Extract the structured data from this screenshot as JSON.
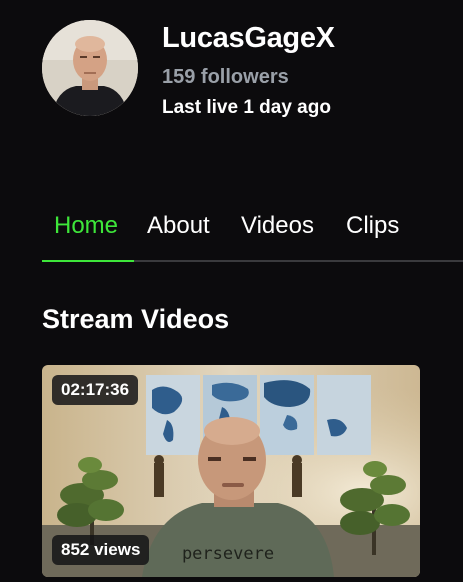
{
  "channel": {
    "name": "LucasGageX",
    "followers": "159 followers",
    "last_live": "Last live 1 day ago"
  },
  "tabs": [
    {
      "label": "Home",
      "active": true
    },
    {
      "label": "About",
      "active": false
    },
    {
      "label": "Videos",
      "active": false
    },
    {
      "label": "Clips",
      "active": false
    }
  ],
  "section": {
    "title": "Stream Videos"
  },
  "video": {
    "duration": "02:17:36",
    "views": "852 views",
    "shirt_text": "persevere"
  },
  "colors": {
    "accent": "#3ee63a",
    "background": "#0c0b0d",
    "muted": "#9aa0a8"
  }
}
